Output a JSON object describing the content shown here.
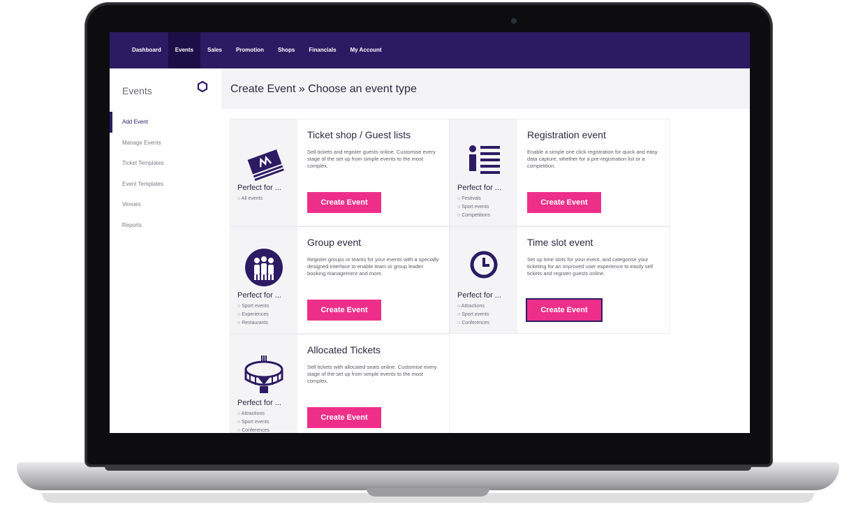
{
  "colors": {
    "nav_bg": "#2c1b63",
    "accent": "#ee2f8a",
    "text": "#2d2740"
  },
  "nav": {
    "items": [
      "Dashboard",
      "Events",
      "Sales",
      "Promotion",
      "Shops",
      "Financials",
      "My Account"
    ],
    "active": "Events"
  },
  "sidebar": {
    "title": "Events",
    "settings_icon": "hexagon-settings-icon",
    "items": [
      "Add Event",
      "Manage Events",
      "Ticket Templates",
      "Event Templates",
      "Venues",
      "Reports"
    ],
    "active": "Add Event"
  },
  "page": {
    "breadcrumb": "Create Event » Choose an event type"
  },
  "cards": [
    {
      "title": "Ticket shop / Guest lists",
      "description": "Sell tickets and register guests online. Customise every stage of the set up from simple events to the most complex.",
      "perfect_for": "Perfect for ...",
      "tags": [
        "All events"
      ],
      "button": "Create Event",
      "icon": "ticket-icon"
    },
    {
      "title": "Registration event",
      "description": "Enable a simple one click registration for quick and easy data capture, whether for a pre-registration list or a competition.",
      "perfect_for": "Perfect for ...",
      "tags": [
        "Festivals",
        "Sport events",
        "Competitions"
      ],
      "button": "Create Event",
      "icon": "registration-list-icon"
    },
    {
      "title": "Group event",
      "description": "Register groups or teams for your events with a specially designed interface to enable team or group leader booking management and more.",
      "perfect_for": "Perfect for ...",
      "tags": [
        "Sport events",
        "Experiences",
        "Restaurants"
      ],
      "button": "Create Event",
      "icon": "group-icon"
    },
    {
      "title": "Time slot event",
      "description": "Set up time slots for your event, and categorise your ticketing for an improved user experience to easily sell tickets and register guests online.",
      "perfect_for": "Perfect for ...",
      "tags": [
        "Attractions",
        "Sport events",
        "Conferences"
      ],
      "button": "Create Event",
      "icon": "clock-icon"
    },
    {
      "title": "Allocated Tickets",
      "description": "Sell tickets with allocated seats online. Customise every stage of the set up from simple events to the most complex.",
      "perfect_for": "Perfect for ...",
      "tags": [
        "Attractions",
        "Sport events",
        "Conferences"
      ],
      "button": "Create Event",
      "icon": "stadium-icon"
    }
  ]
}
